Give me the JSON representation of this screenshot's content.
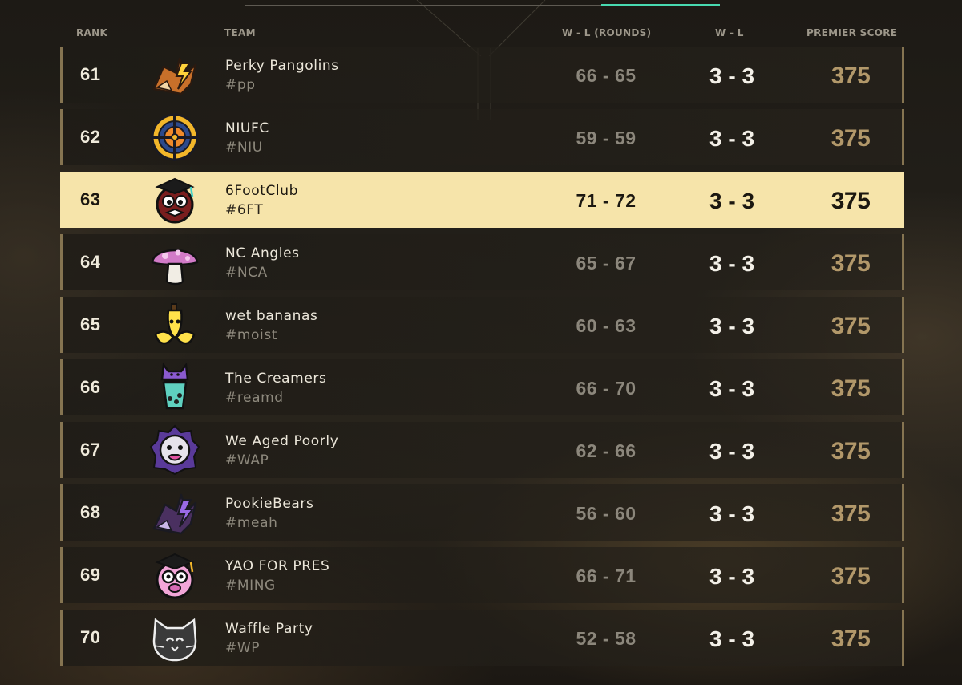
{
  "table": {
    "headers": {
      "rank": "RANK",
      "team": "TEAM",
      "wl_rounds": "W - L (ROUNDS)",
      "wl": "W - L",
      "premier_score": "PREMIER SCORE"
    },
    "highlight_color": "#f6e4aa",
    "active_tab_color": "#48d9b0",
    "rows": [
      {
        "rank": "61",
        "name": "Perky Pangolins",
        "tag": "#pp",
        "rounds": "66 - 65",
        "wl": "3 - 3",
        "score": "375",
        "emblem": "fox-lightning-icon"
      },
      {
        "rank": "62",
        "name": "NIUFC",
        "tag": "#NIU",
        "rounds": "59 - 59",
        "wl": "3 - 3",
        "score": "375",
        "emblem": "crosshair-target-icon"
      },
      {
        "rank": "63",
        "name": "6FootClub",
        "tag": "#6FT",
        "rounds": "71 - 72",
        "wl": "3 - 3",
        "score": "375",
        "emblem": "graduate-creature-icon"
      },
      {
        "rank": "64",
        "name": "NC Angles",
        "tag": "#NCA",
        "rounds": "65 - 67",
        "wl": "3 - 3",
        "score": "375",
        "emblem": "mushroom-icon"
      },
      {
        "rank": "65",
        "name": "wet bananas",
        "tag": "#moist",
        "rounds": "60 - 63",
        "wl": "3 - 3",
        "score": "375",
        "emblem": "banana-icon"
      },
      {
        "rank": "66",
        "name": "The Creamers",
        "tag": "#reamd",
        "rounds": "66 - 70",
        "wl": "3 - 3",
        "score": "375",
        "emblem": "boba-cat-icon"
      },
      {
        "rank": "67",
        "name": "We Aged Poorly",
        "tag": "#WAP",
        "rounds": "62 - 66",
        "wl": "3 - 3",
        "score": "375",
        "emblem": "bulldog-icon"
      },
      {
        "rank": "68",
        "name": "PookieBears",
        "tag": "#meah",
        "rounds": "56 - 60",
        "wl": "3 - 3",
        "score": "375",
        "emblem": "wolf-lightning-icon"
      },
      {
        "rank": "69",
        "name": "YAO FOR PRES",
        "tag": "#MING",
        "rounds": "66 - 71",
        "wl": "3 - 3",
        "score": "375",
        "emblem": "graduate-pig-icon"
      },
      {
        "rank": "70",
        "name": "Waffle Party",
        "tag": "#WP",
        "rounds": "52 - 58",
        "wl": "3 - 3",
        "score": "375",
        "emblem": "cat-face-icon"
      }
    ]
  }
}
